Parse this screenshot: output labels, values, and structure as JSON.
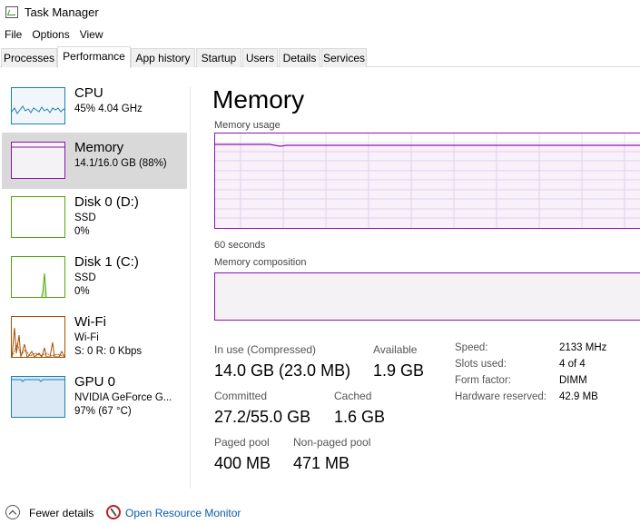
{
  "window": {
    "title": "Task Manager"
  },
  "menu": [
    "File",
    "Options",
    "View"
  ],
  "tabs": [
    "Processes",
    "Performance",
    "App history",
    "Startup",
    "Users",
    "Details",
    "Services"
  ],
  "active_tab": "Performance",
  "sidebar": {
    "items": [
      {
        "title": "CPU",
        "lines": [
          "45%  4.04 GHz"
        ],
        "color": "#1c7fb6"
      },
      {
        "title": "Memory",
        "lines": [
          "14.1/16.0 GB (88%)"
        ],
        "color": "#8b12ae",
        "selected": true
      },
      {
        "title": "Disk 0 (D:)",
        "lines": [
          "SSD",
          "0%"
        ],
        "color": "#4da60c"
      },
      {
        "title": "Disk 1 (C:)",
        "lines": [
          "SSD",
          "0%"
        ],
        "color": "#4da60c"
      },
      {
        "title": "Wi-Fi",
        "lines": [
          "Wi-Fi",
          "S: 0  R: 0 Kbps"
        ],
        "color": "#a74f01"
      },
      {
        "title": "GPU 0",
        "lines": [
          "NVIDIA GeForce G...",
          "97%  (67 °C)"
        ],
        "color": "#1c7fb6"
      }
    ]
  },
  "main": {
    "title": "Memory",
    "usage_label": "Memory usage",
    "time_label": "60 seconds",
    "composition_label": "Memory composition",
    "stats": {
      "in_use_label": "In use (Compressed)",
      "in_use_value": "14.0 GB (23.0 MB)",
      "available_label": "Available",
      "available_value": "1.9 GB",
      "committed_label": "Committed",
      "committed_value": "27.2/55.0 GB",
      "cached_label": "Cached",
      "cached_value": "1.6 GB",
      "paged_label": "Paged pool",
      "paged_value": "400 MB",
      "nonpaged_label": "Non-paged pool",
      "nonpaged_value": "471 MB"
    },
    "specs": [
      {
        "label": "Speed:",
        "value": "2133 MHz"
      },
      {
        "label": "Slots used:",
        "value": "4 of 4"
      },
      {
        "label": "Form factor:",
        "value": "DIMM"
      },
      {
        "label": "Hardware reserved:",
        "value": "42.9 MB"
      }
    ]
  },
  "footer": {
    "fewer_details": "Fewer details",
    "open_resource_monitor": "Open Resource Monitor"
  },
  "colors": {
    "memory": "#8b12ae",
    "cpu": "#1c7fb6",
    "disk": "#4da60c",
    "wifi": "#a74f01",
    "link": "#0b5cad"
  }
}
